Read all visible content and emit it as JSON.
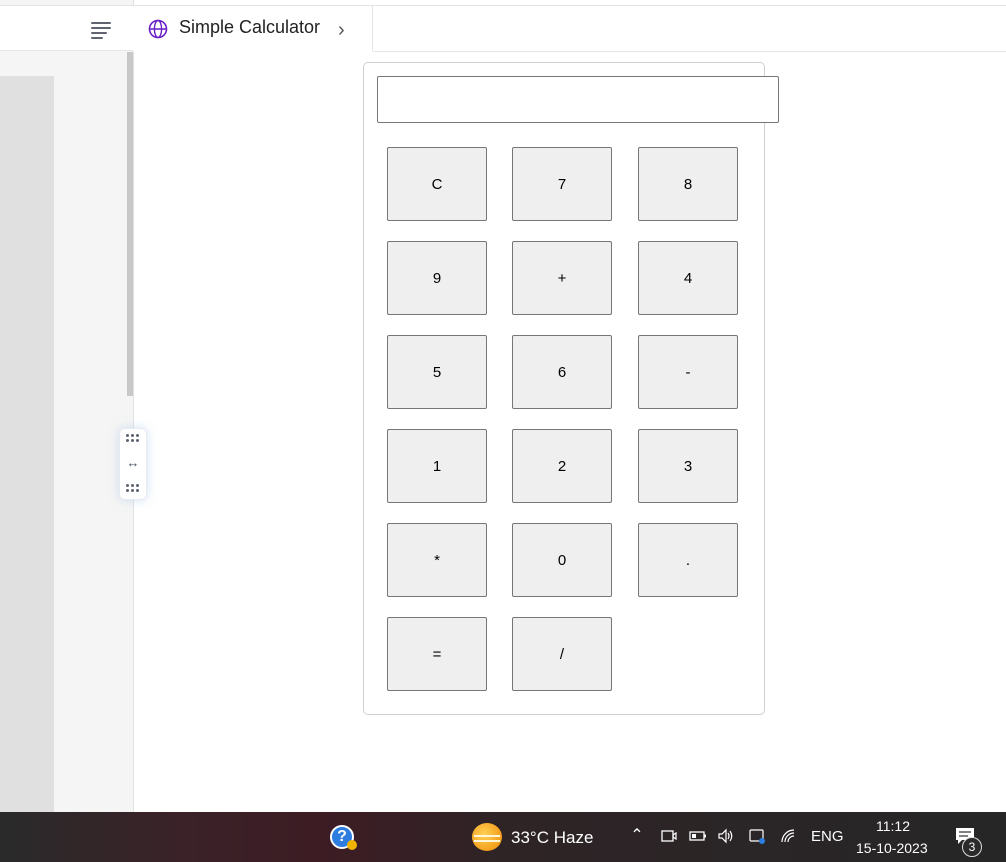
{
  "tab": {
    "title": "Simple Calculator"
  },
  "calculator": {
    "display_value": "",
    "buttons": [
      "C",
      "7",
      "8",
      "9",
      "+",
      "4",
      "5",
      "6",
      "-",
      "1",
      "2",
      "3",
      "*",
      "0",
      ".",
      "=",
      "/"
    ]
  },
  "taskbar": {
    "weather": "33°C  Haze",
    "language": "ENG",
    "time": "11:12",
    "date": "15-10-2023",
    "notification_count": "3"
  }
}
